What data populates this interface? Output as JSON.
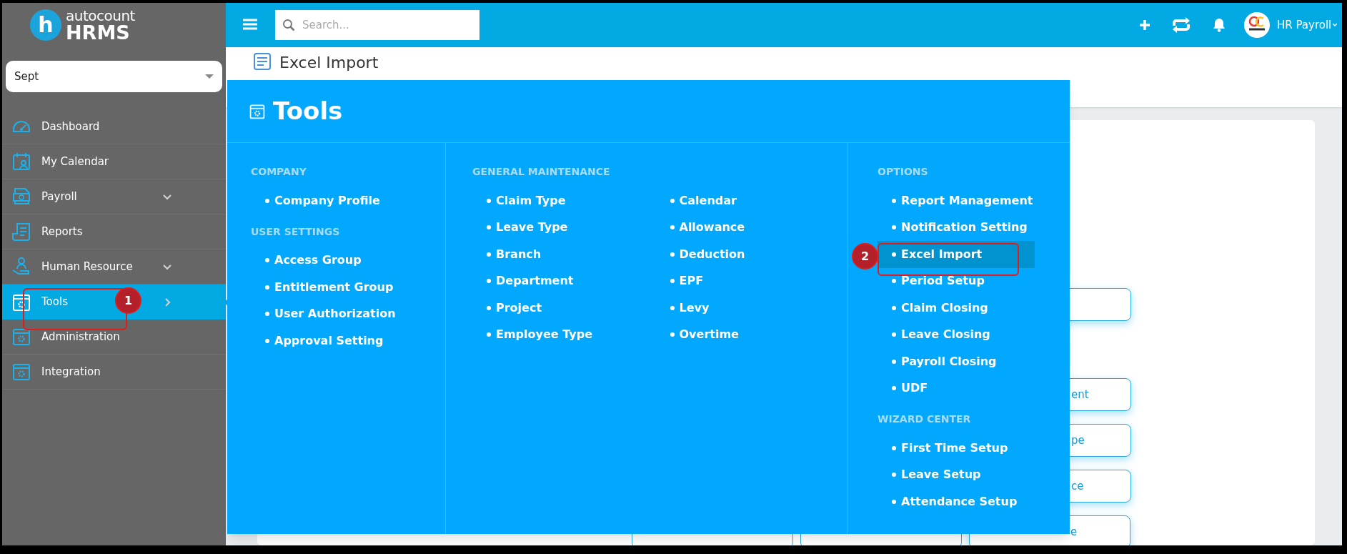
{
  "sidebar": {
    "logo": {
      "mark": "h",
      "brand": "autocount",
      "product": "HRMS"
    },
    "period_select": {
      "value": "Sept"
    },
    "items": [
      {
        "label": "Dashboard",
        "kind": "gauge",
        "selected": false,
        "expandable": false,
        "has_flyout": false
      },
      {
        "label": "My Calendar",
        "kind": "calendar",
        "selected": false,
        "expandable": false,
        "has_flyout": false
      },
      {
        "label": "Payroll",
        "kind": "money",
        "selected": false,
        "expandable": true,
        "has_flyout": false
      },
      {
        "label": "Reports",
        "kind": "report",
        "selected": false,
        "expandable": false,
        "has_flyout": false
      },
      {
        "label": "Human Resource",
        "kind": "person",
        "selected": false,
        "expandable": true,
        "has_flyout": false
      },
      {
        "label": "Tools",
        "kind": "window",
        "selected": true,
        "expandable": false,
        "has_flyout": true
      },
      {
        "label": "Administration",
        "kind": "window",
        "selected": false,
        "expandable": false,
        "has_flyout": false
      },
      {
        "label": "Integration",
        "kind": "window",
        "selected": false,
        "expandable": false,
        "has_flyout": false
      }
    ]
  },
  "top_bar": {
    "search": {
      "placeholder": "Search..."
    },
    "user": "HR Payroll"
  },
  "page_header": {
    "title": "Excel Import"
  },
  "background_buttons": [
    "ent",
    "pe",
    "ce",
    "e"
  ],
  "mega_menu": {
    "title": "Tools",
    "columns": [
      {
        "sections": [
          {
            "heading": "COMPANY",
            "items": [
              {
                "label": "Company Profile",
                "selected": false
              }
            ]
          },
          {
            "heading": "USER SETTINGS",
            "items": [
              {
                "label": "Access Group",
                "selected": false
              },
              {
                "label": "Entitlement Group",
                "selected": false
              },
              {
                "label": "User Authorization",
                "selected": false
              },
              {
                "label": "Approval Setting",
                "selected": false
              }
            ]
          }
        ]
      },
      {
        "sections": [
          {
            "heading": "GENERAL MAINTENANCE",
            "items": [
              {
                "label": "Claim Type",
                "selected": false
              },
              {
                "label": "Leave Type",
                "selected": false
              },
              {
                "label": "Branch",
                "selected": false
              },
              {
                "label": "Department",
                "selected": false
              },
              {
                "label": "Project",
                "selected": false
              },
              {
                "label": "Employee Type",
                "selected": false
              },
              {
                "label": "Calendar",
                "selected": false
              },
              {
                "label": "Allowance",
                "selected": false
              },
              {
                "label": "Deduction",
                "selected": false
              },
              {
                "label": "EPF",
                "selected": false
              },
              {
                "label": "Levy",
                "selected": false
              },
              {
                "label": "Overtime",
                "selected": false
              }
            ]
          }
        ]
      },
      {
        "sections": [
          {
            "heading": "OPTIONS",
            "items": [
              {
                "label": "Report Management",
                "selected": false
              },
              {
                "label": "Notification Setting",
                "selected": false
              },
              {
                "label": "Excel Import",
                "selected": true
              },
              {
                "label": "Period Setup",
                "selected": false
              },
              {
                "label": "Claim Closing",
                "selected": false
              },
              {
                "label": "Leave Closing",
                "selected": false
              },
              {
                "label": "Payroll Closing",
                "selected": false
              },
              {
                "label": "UDF",
                "selected": false
              }
            ]
          },
          {
            "heading": "WIZARD CENTER",
            "items": [
              {
                "label": "First Time Setup",
                "selected": false
              },
              {
                "label": "Leave Setup",
                "selected": false
              },
              {
                "label": "Attendance Setup",
                "selected": false
              }
            ]
          }
        ]
      }
    ]
  },
  "annotations": [
    {
      "number": "1"
    },
    {
      "number": "2"
    }
  ]
}
